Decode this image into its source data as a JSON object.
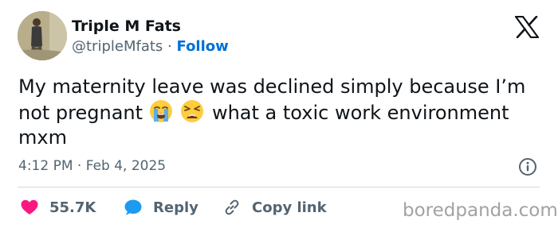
{
  "author": {
    "name": "Triple M Fats",
    "handle": "@tripleMfats",
    "separator": "·",
    "follow_label": "Follow"
  },
  "tweet": {
    "text_part1": "My maternity leave was declined simply because I’m not pregnant",
    "emoji_1": "loudly-crying-face",
    "emoji_2": "weary-face",
    "text_part2": "what a toxic work environment mxm",
    "time": "4:12 PM",
    "date_separator": "·",
    "date": "Feb 4, 2025"
  },
  "actions": {
    "like_count": "55.7K",
    "reply_label": "Reply",
    "copy_link_label": "Copy link"
  },
  "watermark": "boredpanda.com",
  "icons": {
    "platform": "x-logo-icon",
    "info": "info-icon",
    "like": "heart-icon",
    "reply": "speech-bubble-icon",
    "copy_link": "link-icon"
  },
  "colors": {
    "text": "#0f1419",
    "secondary_text": "#536471",
    "follow_link": "#006fd6",
    "like_heart": "#f91880",
    "reply_bubble": "#1d9bf0",
    "divider": "#cfd9de",
    "watermark": "#a2a2a2"
  }
}
